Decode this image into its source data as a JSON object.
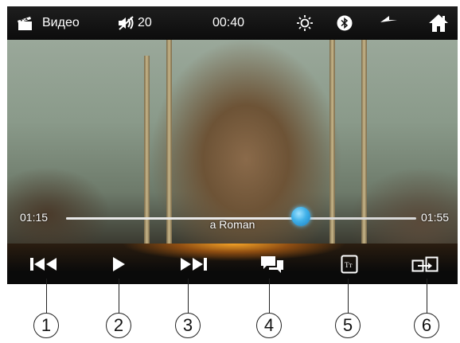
{
  "statusbar": {
    "title": "Видео",
    "volume": "20",
    "clock": "00:40",
    "icons": [
      "video-clapper-icon",
      "volume-muted-icon",
      "brightness-icon",
      "bluetooth-icon",
      "back-icon",
      "home-icon"
    ]
  },
  "player": {
    "elapsed": "01:15",
    "duration": "01:55",
    "progress": 0.67,
    "subtitle": "a Roman"
  },
  "controls": {
    "icons": [
      "previous-icon",
      "play-icon",
      "next-icon",
      "subtitles-icon",
      "text-size-icon",
      "output-switch-icon"
    ]
  },
  "callouts": [
    "1",
    "2",
    "3",
    "4",
    "5",
    "6"
  ],
  "colors": {
    "seek_knob": "#3fb0e8",
    "control_glow": "#ffaa28",
    "bar_background": "#0c0c0c"
  }
}
